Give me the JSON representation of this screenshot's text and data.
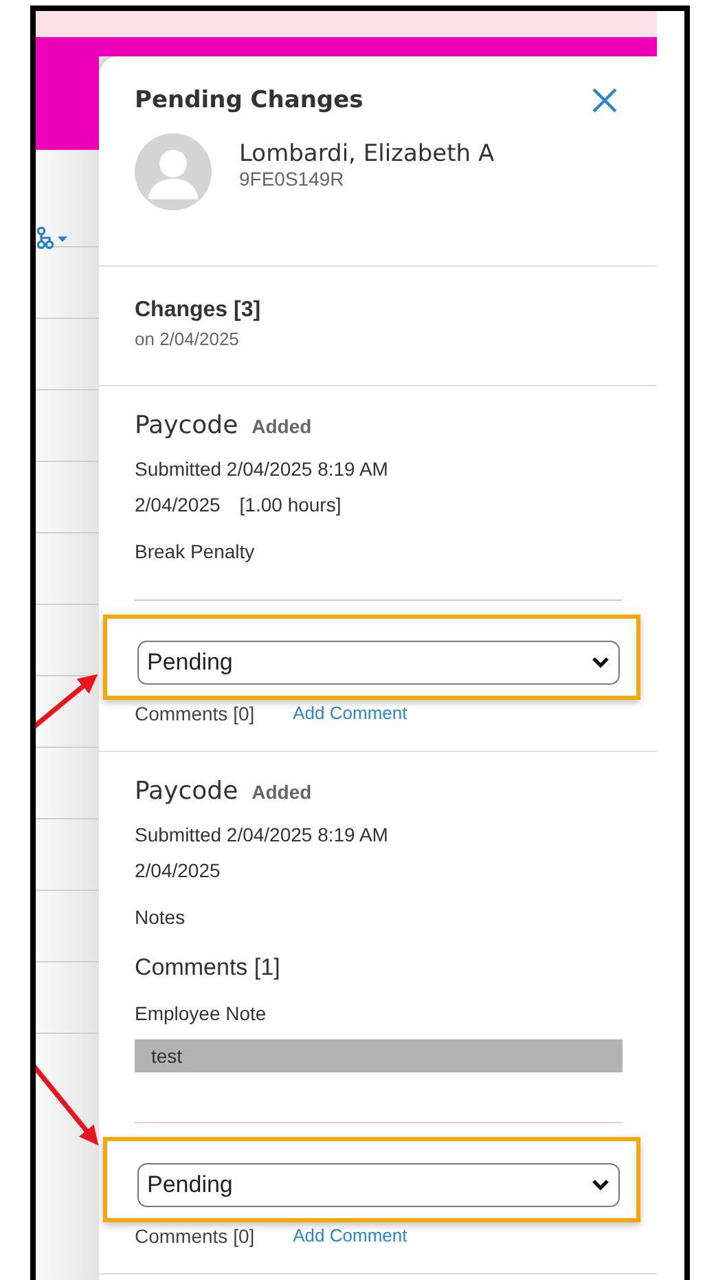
{
  "panel": {
    "title": "Pending Changes"
  },
  "employee": {
    "name": "Lombardi, Elizabeth A",
    "id": "9FE0S149R"
  },
  "changes": {
    "title": "Changes [3]",
    "date": "on 2/04/2025"
  },
  "items": [
    {
      "type": "Paycode",
      "action": "Added",
      "submitted": "Submitted 2/04/2025 8:19 AM",
      "date": "2/04/2025",
      "hours": "[1.00 hours]",
      "detail": "Break Penalty",
      "status": "Pending",
      "comments": "Comments [0]",
      "add_comment": "Add Comment",
      "highlighted": true,
      "kind": "arrow_below"
    },
    {
      "type": "Paycode",
      "action": "Added",
      "submitted": "Submitted 2/04/2025 8:19 AM",
      "date": "2/04/2025",
      "detail": "Notes",
      "comments_title": "Comments [1]",
      "note": {
        "label": "Employee Note",
        "text": "test"
      },
      "status": "Pending",
      "comments": "Comments [0]",
      "add_comment": "Add Comment",
      "highlighted": true,
      "kind": "arrow_above"
    }
  ]
}
